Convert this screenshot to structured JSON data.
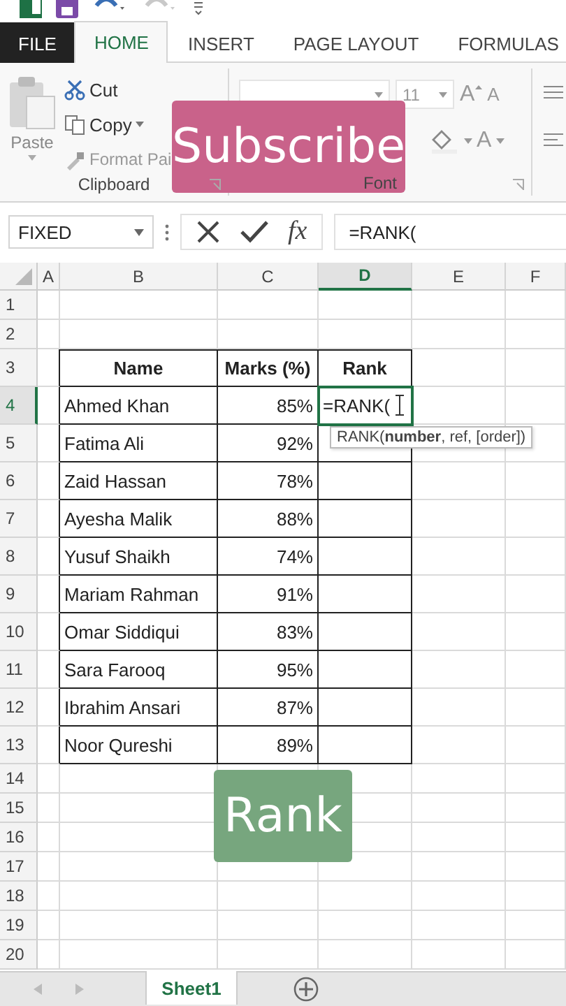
{
  "tabs": [
    {
      "label": "FILE",
      "kind": "file",
      "selected": false
    },
    {
      "label": "HOME",
      "kind": "tab",
      "selected": true
    },
    {
      "label": "INSERT",
      "kind": "tab",
      "selected": false
    },
    {
      "label": "PAGE LAYOUT",
      "kind": "tab",
      "selected": false
    },
    {
      "label": "FORMULAS",
      "kind": "tab",
      "selected": false
    }
  ],
  "clipboard": {
    "paste": "Paste",
    "cut": "Cut",
    "copy": "Copy",
    "format_painter": "Format Pai",
    "label": "Clipboard"
  },
  "font": {
    "size": "11",
    "grow": "A",
    "shrink": "A",
    "font_color": "A",
    "label": "Font"
  },
  "formula_bar": {
    "name_box": "FIXED",
    "fx": "fx",
    "formula": "=RANK("
  },
  "columns": [
    {
      "label": "A",
      "selected": false
    },
    {
      "label": "B",
      "selected": false
    },
    {
      "label": "C",
      "selected": false
    },
    {
      "label": "D",
      "selected": true
    },
    {
      "label": "E",
      "selected": false
    },
    {
      "label": "F",
      "selected": false
    }
  ],
  "row_numbers": [
    {
      "label": "1",
      "selected": false
    },
    {
      "label": "2",
      "selected": false
    },
    {
      "label": "3",
      "selected": false
    },
    {
      "label": "4",
      "selected": true
    },
    {
      "label": "5",
      "selected": false
    },
    {
      "label": "6",
      "selected": false
    },
    {
      "label": "7",
      "selected": false
    },
    {
      "label": "8",
      "selected": false
    },
    {
      "label": "9",
      "selected": false
    },
    {
      "label": "10",
      "selected": false
    },
    {
      "label": "11",
      "selected": false
    },
    {
      "label": "12",
      "selected": false
    },
    {
      "label": "13",
      "selected": false
    },
    {
      "label": "14",
      "selected": false
    },
    {
      "label": "15",
      "selected": false
    },
    {
      "label": "16",
      "selected": false
    },
    {
      "label": "17",
      "selected": false
    },
    {
      "label": "18",
      "selected": false
    },
    {
      "label": "19",
      "selected": false
    },
    {
      "label": "20",
      "selected": false
    }
  ],
  "table": {
    "header": [
      "Name",
      "Marks (%)",
      "Rank"
    ],
    "rows": [
      {
        "name": "Ahmed Khan",
        "marks": "85%",
        "rank": "=RANK(",
        "editing": true
      },
      {
        "name": "Fatima Ali",
        "marks": "92%",
        "editing": false
      },
      {
        "name": "Zaid Hassan",
        "marks": "78%",
        "editing": false
      },
      {
        "name": "Ayesha Malik",
        "marks": "88%",
        "editing": false
      },
      {
        "name": "Yusuf Shaikh",
        "marks": "74%",
        "editing": false
      },
      {
        "name": "Mariam Rahman",
        "marks": "91%",
        "editing": false
      },
      {
        "name": "Omar Siddiqui",
        "marks": "83%",
        "editing": false
      },
      {
        "name": "Sara Farooq",
        "marks": "95%",
        "editing": false
      },
      {
        "name": "Ibrahim Ansari",
        "marks": "87%",
        "editing": false
      },
      {
        "name": "Noor Qureshi",
        "marks": "89%",
        "editing": false
      }
    ]
  },
  "tooltip": "RANK(**number**, ref, [order])",
  "overlays": [
    {
      "text": "Subscribe",
      "color": "#c9628a"
    },
    {
      "text": "Rank",
      "color": "#77a67e"
    }
  ],
  "sheet_tabs": [
    {
      "label": "Sheet1",
      "selected": true
    }
  ]
}
